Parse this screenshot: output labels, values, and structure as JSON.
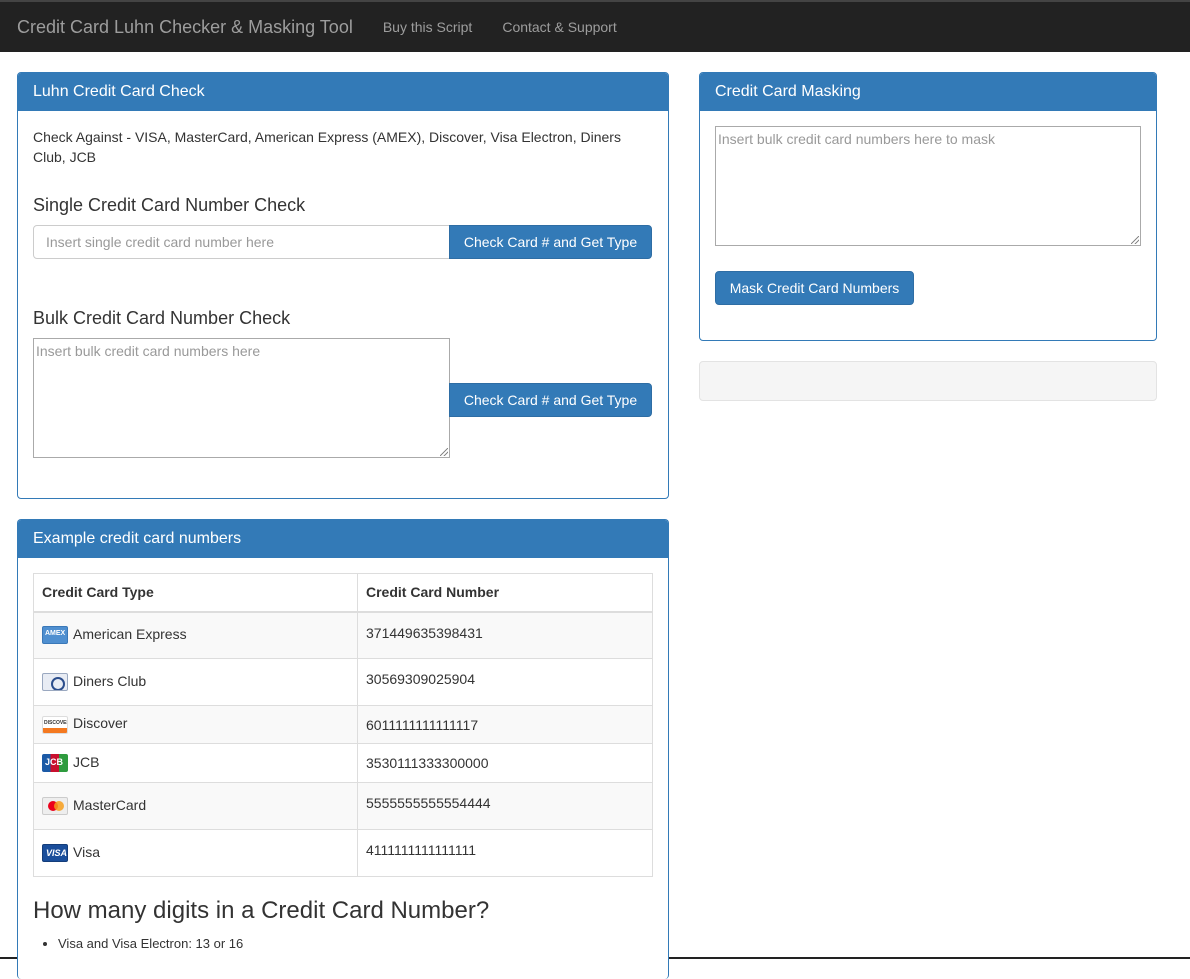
{
  "navbar": {
    "brand": "Credit Card Luhn Checker & Masking Tool",
    "links": [
      "Buy this Script",
      "Contact & Support"
    ]
  },
  "luhn": {
    "heading": "Luhn Credit Card Check",
    "check_against": "Check Against - VISA, MasterCard, American Express (AMEX), Discover, Visa Electron, Diners Club, JCB",
    "single": {
      "title": "Single Credit Card Number Check",
      "placeholder": "Insert single credit card number here",
      "button": "Check Card # and Get Type"
    },
    "bulk": {
      "title": "Bulk Credit Card Number Check",
      "placeholder": "Insert bulk credit card numbers here",
      "button": "Check Card # and Get Type"
    }
  },
  "masking": {
    "heading": "Credit Card Masking",
    "placeholder": "Insert bulk credit card numbers here to mask",
    "button": "Mask Credit Card Numbers"
  },
  "examples": {
    "heading": "Example credit card numbers",
    "columns": [
      "Credit Card Type",
      "Credit Card Number"
    ],
    "rows": [
      {
        "icon": "amex-card-icon",
        "type": "American Express",
        "number": "371449635398431"
      },
      {
        "icon": "diners-club-card-icon",
        "type": "Diners Club",
        "number": "30569309025904"
      },
      {
        "icon": "discover-card-icon",
        "type": "Discover",
        "number": "6011111111111117"
      },
      {
        "icon": "jcb-card-icon",
        "type": "JCB",
        "number": "3530111333300000"
      },
      {
        "icon": "mastercard-card-icon",
        "type": "MasterCard",
        "number": "5555555555554444"
      },
      {
        "icon": "visa-card-icon",
        "type": "Visa",
        "number": "4111111111111111"
      }
    ],
    "digits_title": "How many digits in a Credit Card Number?",
    "digits_items": [
      "Visa and Visa Electron: 13 or 16"
    ]
  }
}
